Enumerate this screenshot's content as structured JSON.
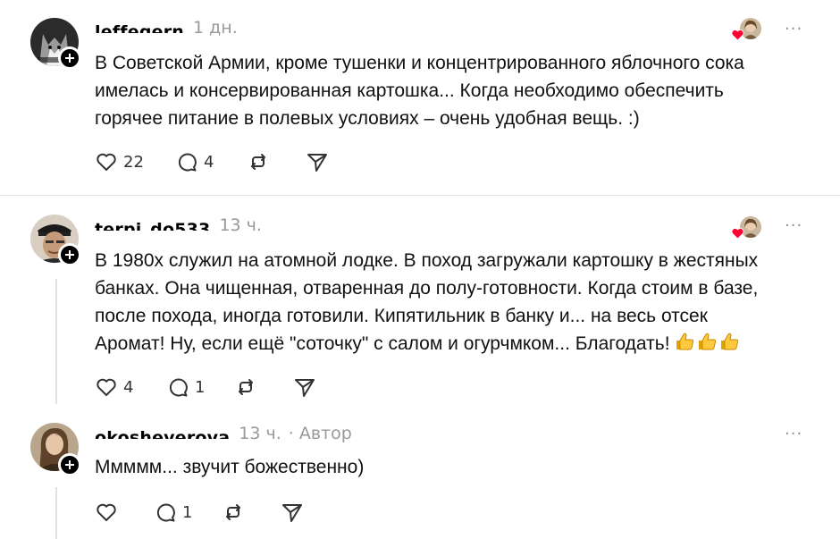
{
  "comments": [
    {
      "username": "leffegern",
      "time": "1 дн.",
      "author_tag": "",
      "lines": [
        "В Советской Армии, кроме тушенки и концентрированного яблочного сока",
        "имелась и консервированная картошка... Когда необходимо обеспечить",
        "горячее питание в полевых условиях – очень удобная вещь. :)"
      ],
      "likes": "22",
      "replies": "4",
      "liked_by_author": true
    },
    {
      "username": "terpi_do533",
      "time": "13 ч.",
      "author_tag": "",
      "lines": [
        "В 1980х служил на атомной лодке. В поход загружали картошку в жестяных",
        "банках. Она чищенная, отваренная до полу-готовности. Когда стоим в базе,",
        "после похода, иногда готовили. Кипятильник в банку и... на весь отсек",
        "Аромат! Ну, если ещё \"соточку\" с салом и огурчмком... Благодать!"
      ],
      "likes": "4",
      "replies": "1",
      "liked_by_author": true
    },
    {
      "username": "okosheverova",
      "time": "13 ч.",
      "author_tag": "· Автор",
      "lines": [
        "Ммммм... звучит божественно)"
      ],
      "likes": "",
      "replies": "1",
      "liked_by_author": false
    }
  ],
  "more_label": "···",
  "icons": {
    "like": "heart-outline-icon",
    "reply": "comment-bubble-icon",
    "repost": "repost-icon",
    "share": "send-icon",
    "follow": "plus-icon",
    "thumbs": "thumbs-up-emoji"
  },
  "colors": {
    "heart_liked": "#ff0034",
    "meta": "#999999",
    "icon": "#333333"
  }
}
